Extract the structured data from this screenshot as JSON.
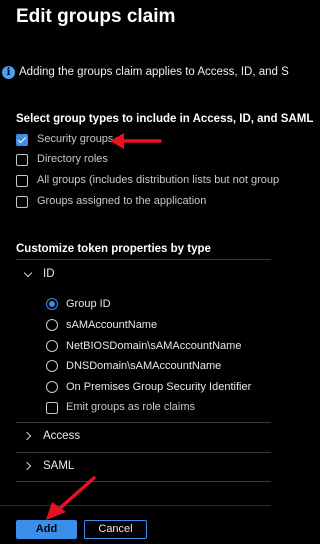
{
  "title": "Edit groups claim",
  "info": {
    "icon": "info-icon",
    "text": "Adding the groups claim applies to Access, ID, and S"
  },
  "group_types": {
    "heading": "Select group types to include in Access, ID, and SAML",
    "options": [
      {
        "label": "Security groups",
        "checked": true
      },
      {
        "label": "Directory roles",
        "checked": false
      },
      {
        "label": "All groups (includes distribution lists but not group",
        "checked": false
      },
      {
        "label": "Groups assigned to the application",
        "checked": false
      }
    ]
  },
  "customize": {
    "heading": "Customize token properties by type",
    "id_section": {
      "label": "ID",
      "expanded": true,
      "radios": [
        {
          "label": "Group ID",
          "selected": true
        },
        {
          "label": "sAMAccountName",
          "selected": false
        },
        {
          "label": "NetBIOSDomain\\sAMAccountName",
          "selected": false
        },
        {
          "label": "DNSDomain\\sAMAccountName",
          "selected": false
        },
        {
          "label": "On Premises Group Security Identifier",
          "selected": false
        }
      ],
      "emit_roles": {
        "label": "Emit groups as role claims",
        "checked": false
      }
    },
    "access_section": {
      "label": "Access",
      "expanded": false
    },
    "saml_section": {
      "label": "SAML",
      "expanded": false
    }
  },
  "footer": {
    "add_label": "Add",
    "cancel_label": "Cancel"
  },
  "colors": {
    "accent": "#3b8eea",
    "annotation_arrow": "#e81123",
    "background": "#000000"
  }
}
